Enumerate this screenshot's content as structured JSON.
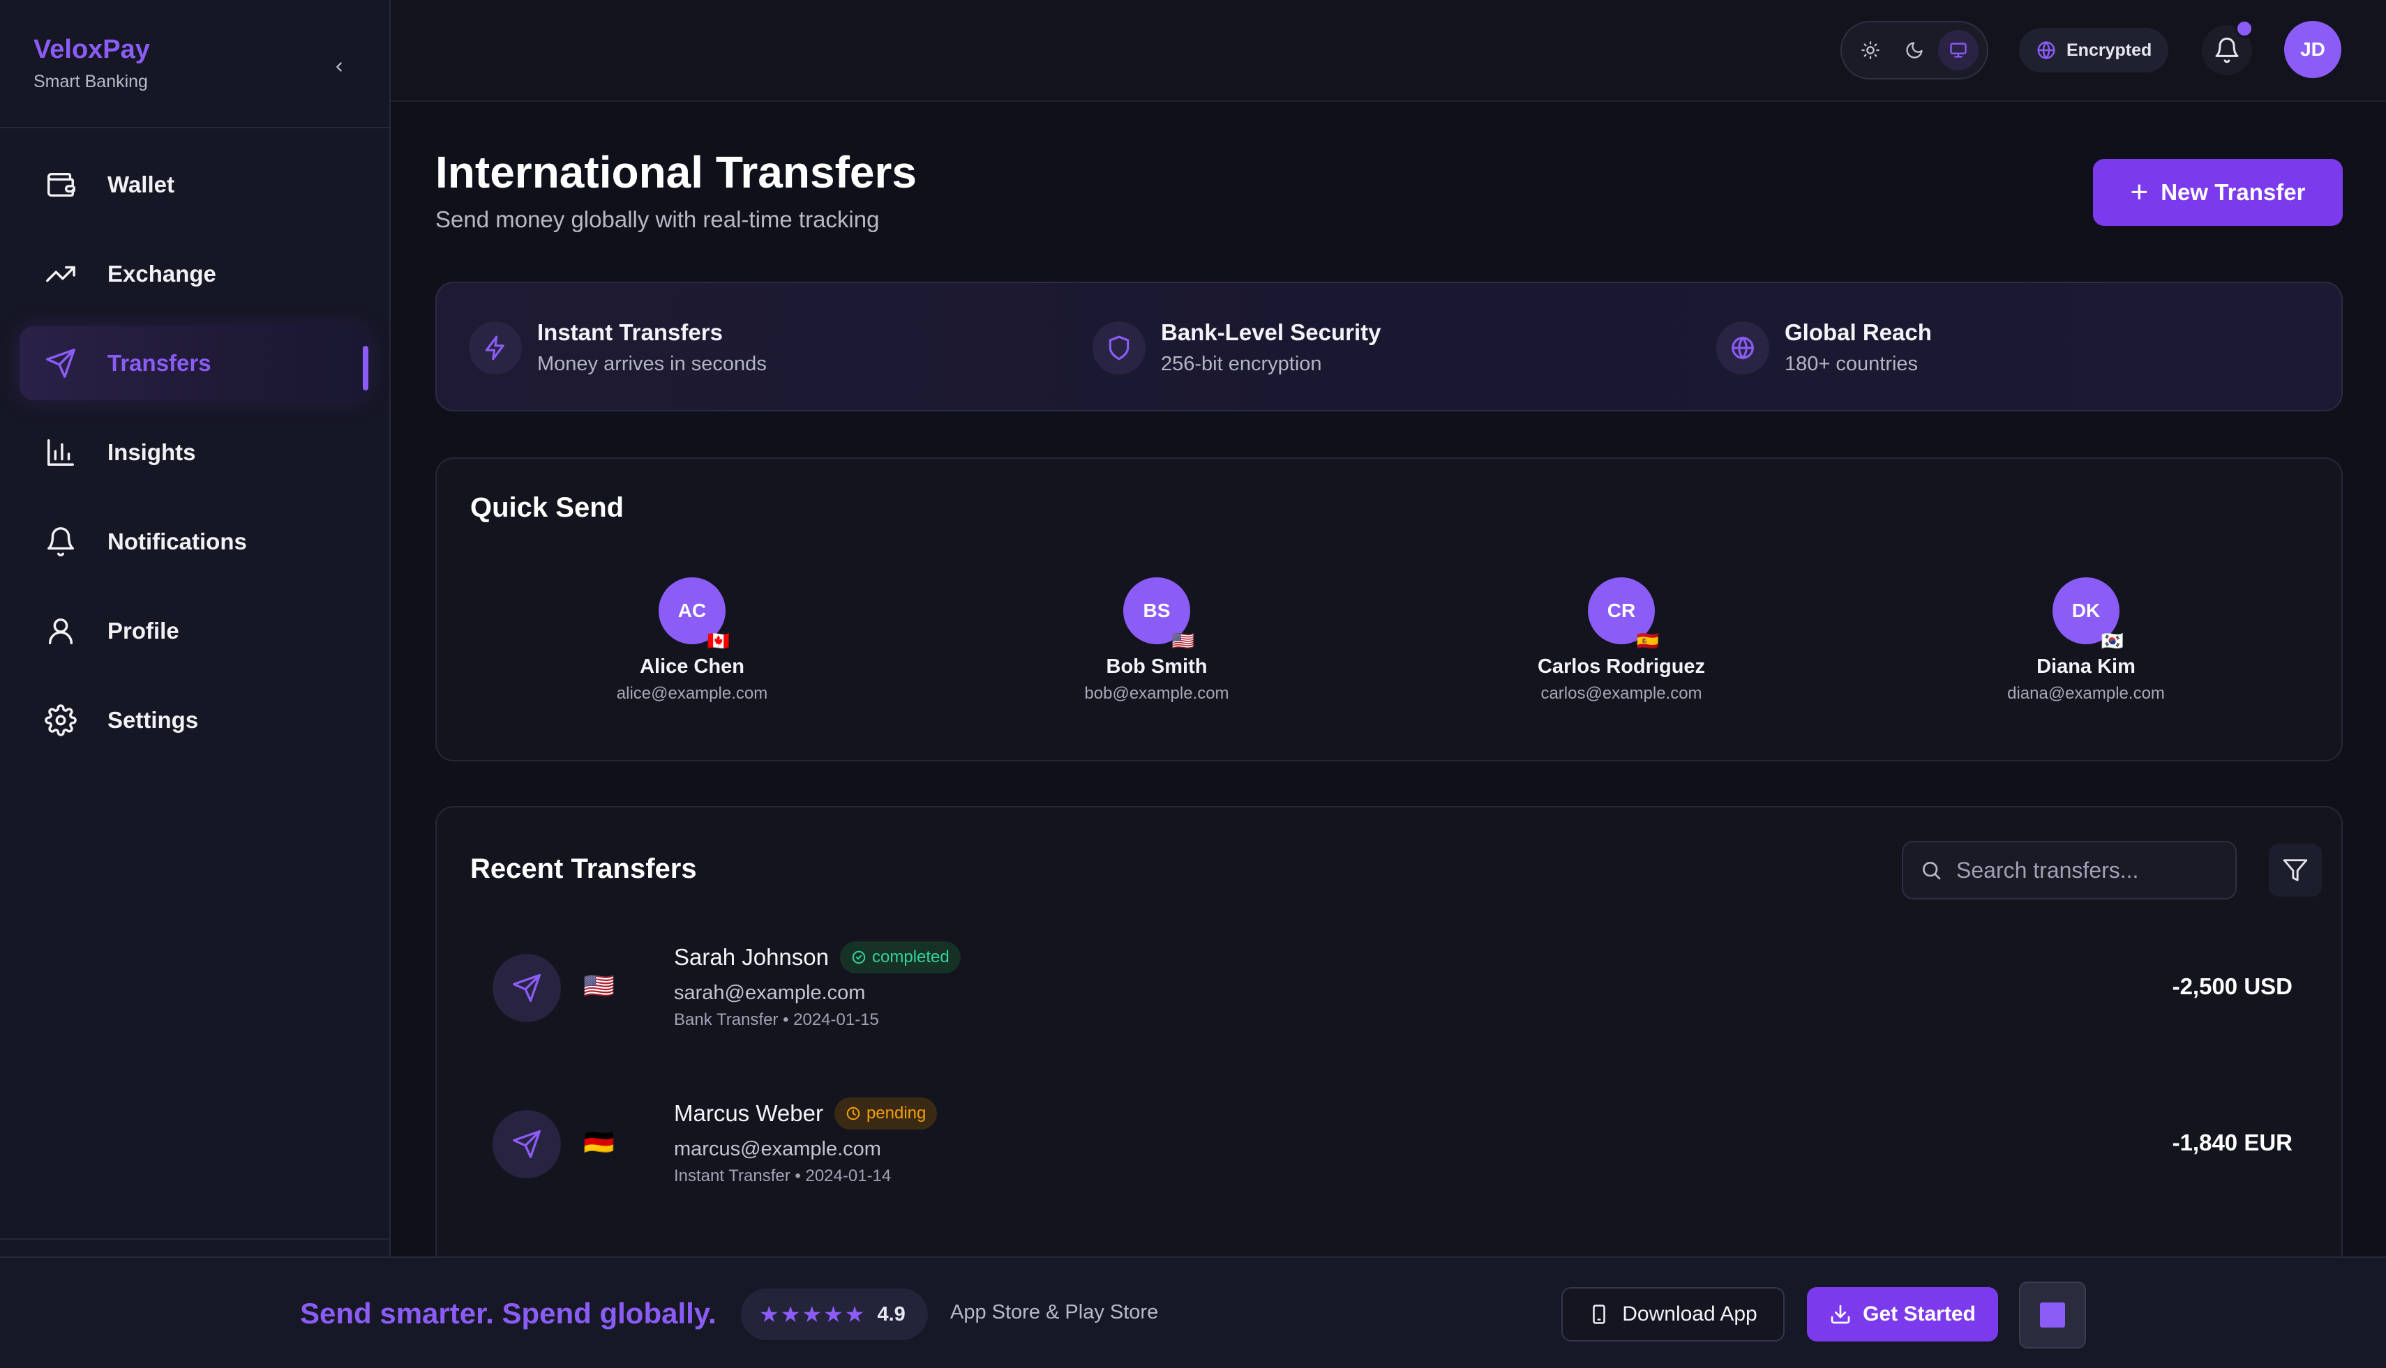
{
  "brand": {
    "name": "VeloxPay",
    "tagline": "Smart Banking"
  },
  "sidebar": {
    "items": [
      {
        "label": "Wallet",
        "icon": "wallet-icon",
        "active": false
      },
      {
        "label": "Exchange",
        "icon": "trending-up-icon",
        "active": false
      },
      {
        "label": "Transfers",
        "icon": "send-icon",
        "active": true
      },
      {
        "label": "Insights",
        "icon": "bar-chart-icon",
        "active": false
      },
      {
        "label": "Notifications",
        "icon": "bell-icon",
        "active": false
      },
      {
        "label": "Profile",
        "icon": "user-icon",
        "active": false
      },
      {
        "label": "Settings",
        "icon": "gear-icon",
        "active": false
      }
    ]
  },
  "topbar": {
    "theme_modes": [
      "light",
      "dark",
      "system"
    ],
    "theme_selected": "system",
    "encryption_label": "Encrypted",
    "user_initials": "JD"
  },
  "page": {
    "title": "International Transfers",
    "subtitle": "Send money globally with real-time tracking",
    "new_transfer_label": "New Transfer"
  },
  "features": [
    {
      "title": "Instant Transfers",
      "subtitle": "Money arrives in seconds",
      "icon": "lightning-icon"
    },
    {
      "title": "Bank-Level Security",
      "subtitle": "256-bit encryption",
      "icon": "shield-icon"
    },
    {
      "title": "Global Reach",
      "subtitle": "180+ countries",
      "icon": "globe-icon"
    }
  ],
  "quick_send": {
    "title": "Quick Send",
    "contacts": [
      {
        "initials": "AC",
        "name": "Alice Chen",
        "email": "alice@example.com",
        "flag": "🇨🇦"
      },
      {
        "initials": "BS",
        "name": "Bob Smith",
        "email": "bob@example.com",
        "flag": "🇺🇸"
      },
      {
        "initials": "CR",
        "name": "Carlos Rodriguez",
        "email": "carlos@example.com",
        "flag": "🇪🇸"
      },
      {
        "initials": "DK",
        "name": "Diana Kim",
        "email": "diana@example.com",
        "flag": "🇰🇷"
      }
    ]
  },
  "recent": {
    "title": "Recent Transfers",
    "search_placeholder": "Search transfers...",
    "transfers": [
      {
        "name": "Sarah Johnson",
        "status": "completed",
        "email": "sarah@example.com",
        "meta": "Bank Transfer • 2024-01-15",
        "amount": "-2,500 USD",
        "flag": "🇺🇸"
      },
      {
        "name": "Marcus Weber",
        "status": "pending",
        "email": "marcus@example.com",
        "meta": "Instant Transfer • 2024-01-14",
        "amount": "-1,840 EUR",
        "flag": "🇩🇪"
      }
    ]
  },
  "bottombar": {
    "promo": "Send smarter. Spend globally.",
    "stars": "★★★★★",
    "rating": "4.9",
    "stores": "App Store & Play Store",
    "download_label": "Download App",
    "get_started_label": "Get Started"
  },
  "colors": {
    "accent": "#8b5cf6",
    "accent_strong": "#7c3aed",
    "completed": "#34d399",
    "pending": "#f59e0b",
    "background": "#0f1019"
  }
}
